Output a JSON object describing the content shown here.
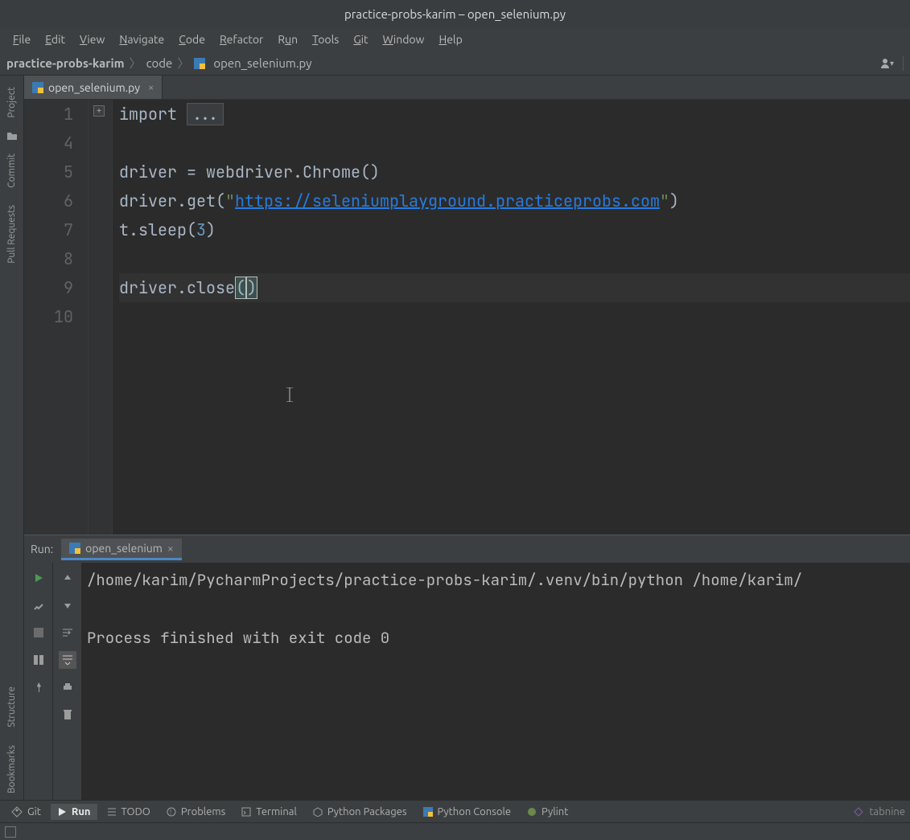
{
  "title": "practice-probs-karim – open_selenium.py",
  "menu": [
    "File",
    "Edit",
    "View",
    "Navigate",
    "Code",
    "Refactor",
    "Run",
    "Tools",
    "Git",
    "Window",
    "Help"
  ],
  "breadcrumbs": {
    "root": "practice-probs-karim",
    "mid": "code",
    "file": "open_selenium.py"
  },
  "tool_windows": {
    "project": "Project",
    "commit": "Commit",
    "pull_requests": "Pull Requests",
    "structure": "Structure",
    "bookmarks": "Bookmarks"
  },
  "editor_tab": {
    "label": "open_selenium.py"
  },
  "code": {
    "line_numbers": [
      "1",
      "4",
      "5",
      "6",
      "7",
      "8",
      "9",
      "10"
    ],
    "l1a": "import ",
    "l1b": "...",
    "l5": "driver = webdriver.Chrome()",
    "l6a": "driver.get(",
    "l6q1": "\"",
    "l6url": "https://seleniumplayground.practiceprobs.com",
    "l6q2": "\"",
    "l6b": ")",
    "l7a": "t.sleep(",
    "l7n": "3",
    "l7b": ")",
    "l9a": "driver.close",
    "l9p1": "(",
    "l9p2": ")"
  },
  "run": {
    "header_label": "Run:",
    "tab_label": "open_selenium",
    "out_line1": "/home/karim/PycharmProjects/practice-probs-karim/.venv/bin/python /home/karim/",
    "out_line2": "Process finished with exit code 0"
  },
  "bottom": {
    "git": "Git",
    "run": "Run",
    "todo": "TODO",
    "problems": "Problems",
    "terminal": "Terminal",
    "pypkg": "Python Packages",
    "pyconsole": "Python Console",
    "pylint": "Pylint",
    "tabnine": "tabnine"
  }
}
